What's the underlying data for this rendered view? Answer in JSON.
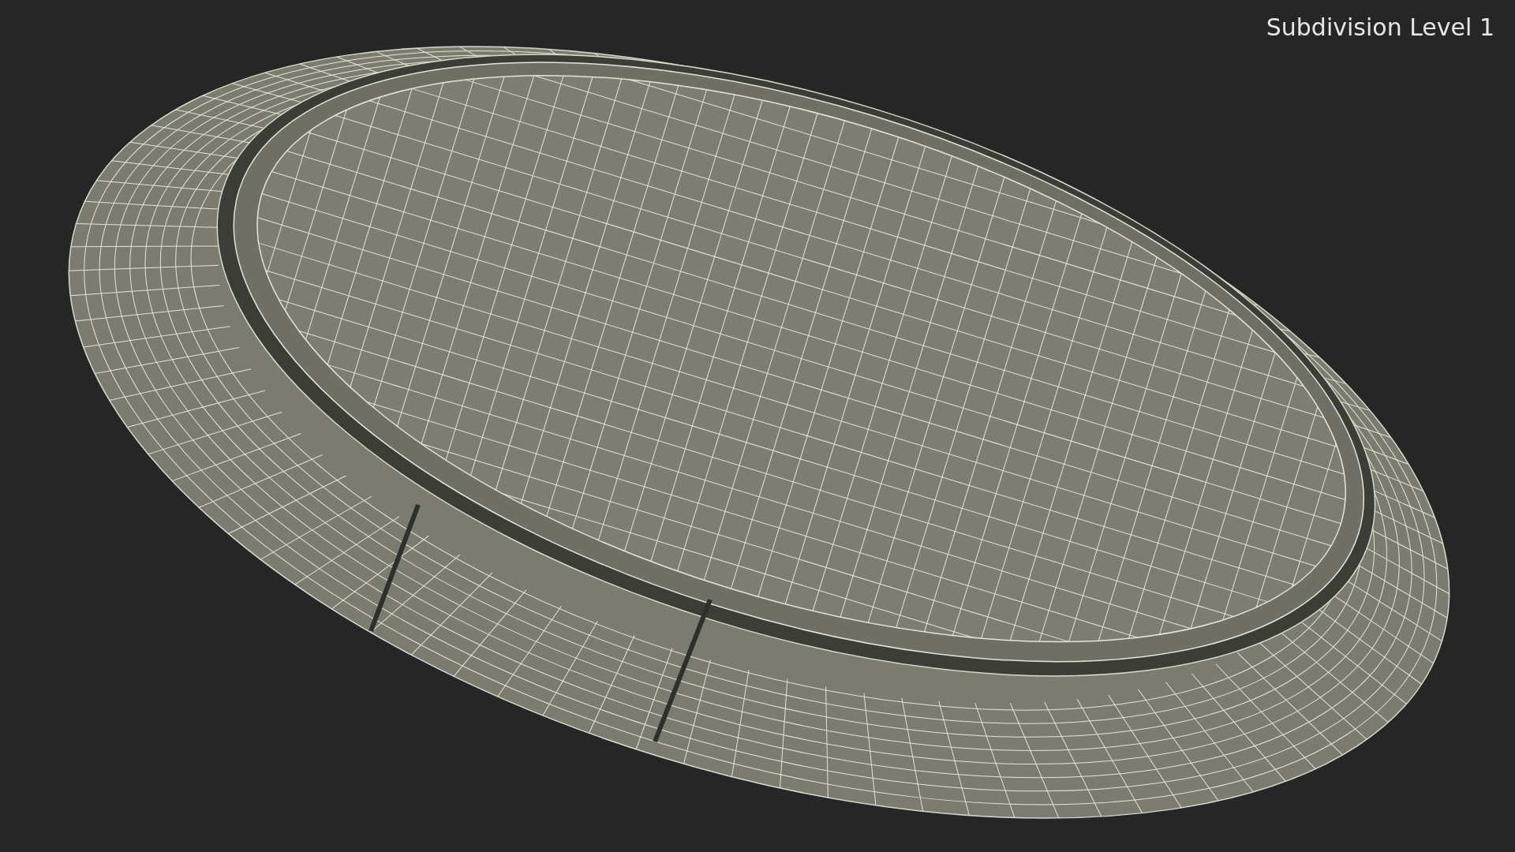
{
  "viewport": {
    "label": "Subdivision Level 1"
  }
}
